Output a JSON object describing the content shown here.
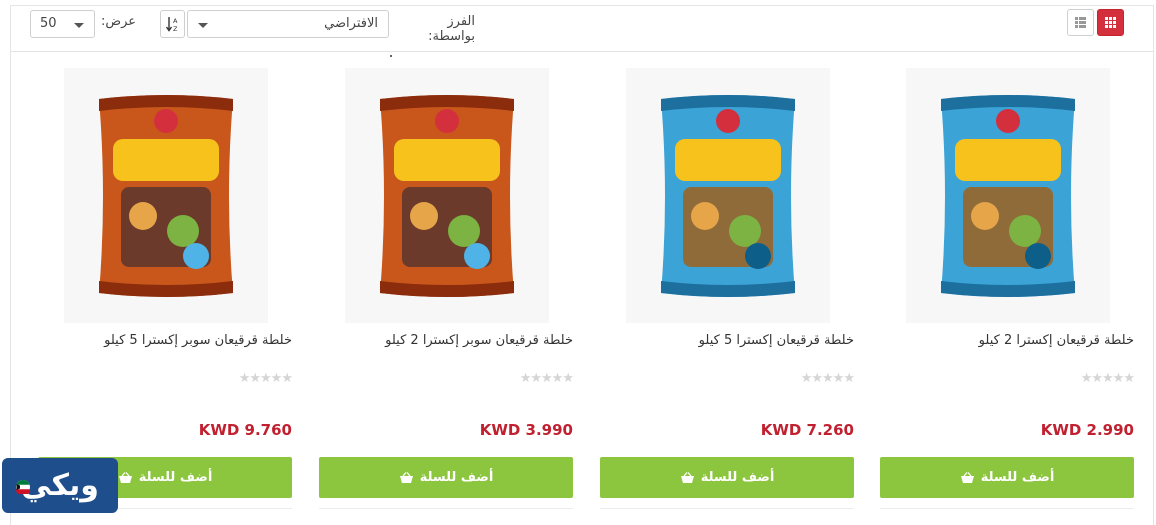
{
  "toolbar": {
    "sort_label": "الفرز بواسطة:",
    "sort_value": "الافتراضي",
    "sort_direction_glyph": "A↓Z",
    "show_label": "عرض:",
    "limit_value": "50"
  },
  "products": [
    {
      "name": "خلطة قرقيعان إكسترا 2 كيلو",
      "price": "KWD 2.990",
      "rating": "★★★★★",
      "button": "أضف للسلة",
      "package_color": "blue"
    },
    {
      "name": "خلطة قرقيعان إكسترا 5 كيلو",
      "price": "KWD 7.260",
      "rating": "★★★★★",
      "button": "أضف للسلة",
      "package_color": "blue"
    },
    {
      "name": "خلطة قرقيعان سوبر إكسترا 2 كيلو",
      "price": "KWD 3.990",
      "rating": "★★★★★",
      "button": "أضف للسلة",
      "package_color": "orange"
    },
    {
      "name": "خلطة قرقيعان سوبر إكسترا 5 كيلو",
      "price": "KWD 9.760",
      "rating": "★★★★★",
      "button": "أضف للسلة",
      "package_color": "orange"
    }
  ],
  "colors": {
    "accent": "#d32f3c",
    "price": "#c0202f",
    "cart_button": "#8cc63f",
    "logo_bg": "#1f4e8c"
  },
  "logo": {
    "text": "ويكي"
  }
}
